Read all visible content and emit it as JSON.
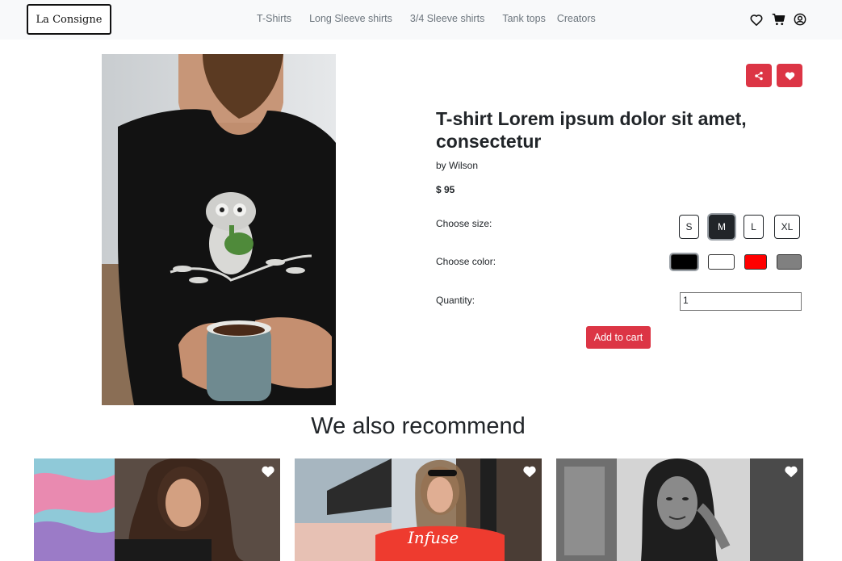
{
  "navbar": {
    "brand": "La Consigne",
    "links": [
      "T-Shirts",
      "Long Sleeve shirts",
      "3/4 Sleeve shirts",
      "Tank tops",
      "Creators"
    ],
    "icons": [
      "heart-icon",
      "cart-icon",
      "user-icon"
    ]
  },
  "product": {
    "title": "T-shirt Lorem ipsum dolor sit amet, consectetur",
    "byline": "by Wilson",
    "price": "$ 95",
    "size_label": "Choose size:",
    "sizes": [
      "S",
      "M",
      "L",
      "XL"
    ],
    "selected_size": "M",
    "color_label": "Choose color:",
    "colors": [
      "#000000",
      "#ffffff",
      "#ff0000",
      "#808080"
    ],
    "selected_color": "#000000",
    "quantity_label": "Quantity:",
    "quantity_value": "1",
    "add_to_cart": "Add to cart",
    "accent": "#dc3545"
  },
  "recommend": {
    "title": "We also recommend"
  }
}
